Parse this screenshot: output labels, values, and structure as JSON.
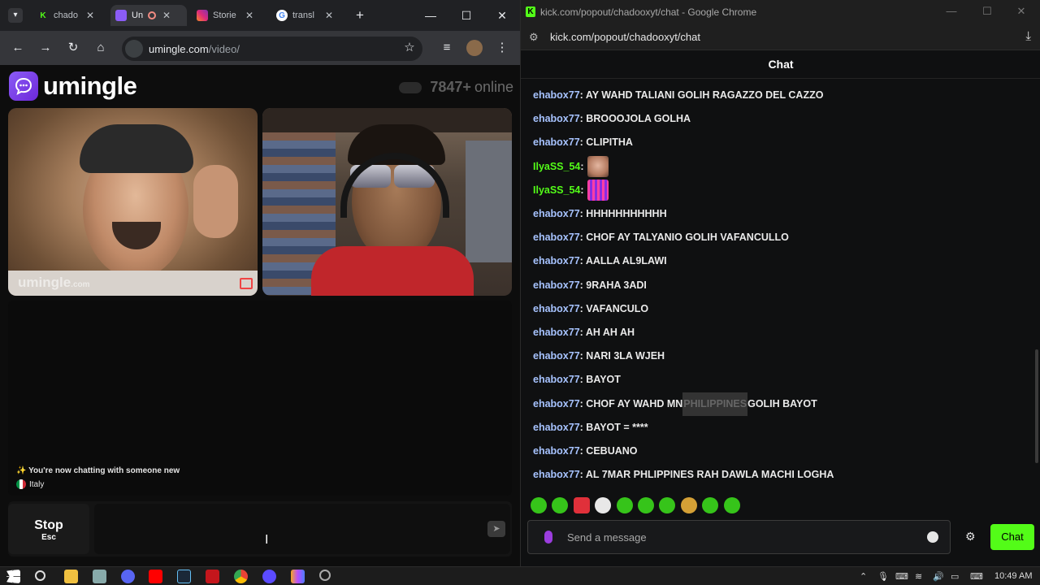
{
  "left_window": {
    "tabs": [
      {
        "label": "chado",
        "favicon": "K",
        "color": "#53fc18"
      },
      {
        "label": "Un",
        "favicon": "U",
        "color": "#8b5cf6"
      },
      {
        "label": "Storie",
        "favicon": "I",
        "color": "#e1306c"
      },
      {
        "label": "transl",
        "favicon": "G",
        "color": "#4285f4"
      }
    ],
    "new_tab": "+",
    "url_host": "umingle.com",
    "url_path": "/video/"
  },
  "umingle": {
    "logo_text": "umingle",
    "online_count": "7847+",
    "online_label": "online",
    "watermark": "umingle",
    "watermark_domain": ".com",
    "system_message": "You're now chatting with someone new",
    "country": "Italy",
    "stop_label": "Stop",
    "stop_shortcut": "Esc"
  },
  "right_window": {
    "title": "kick.com/popout/chadooxyt/chat - Google Chrome",
    "url": "kick.com/popout/chadooxyt/chat",
    "chat_header": "Chat",
    "messages": [
      {
        "user": "ehabox77",
        "text": ": AY WAHD TALIANI GOLIH RAGAZZO DEL CAZZO"
      },
      {
        "user": "ehabox77",
        "text": ": BROOOJOLA GOLHA"
      },
      {
        "user": "ehabox77",
        "text": ": CLIPITHA"
      },
      {
        "user": "IlyaSS_54",
        "text": ":",
        "emote": "face"
      },
      {
        "user": "IlyaSS_54",
        "text": ":",
        "emote": "dance"
      },
      {
        "user": "ehabox77",
        "text": ": HHHHHHHHHHH"
      },
      {
        "user": "ehabox77",
        "text": ": CHOF AY TALYANIO GOLIH VAFANCULLO"
      },
      {
        "user": "ehabox77",
        "text": ": AALLA AL9LAWI"
      },
      {
        "user": "ehabox77",
        "text": ": 9RAHA 3ADI"
      },
      {
        "user": "ehabox77",
        "text": ": VAFANCULO"
      },
      {
        "user": "ehabox77",
        "text": ": AH AH AH"
      },
      {
        "user": "ehabox77",
        "text": ": NARI 3LA WJEH"
      },
      {
        "user": "ehabox77",
        "text": ": BAYOT"
      },
      {
        "user": "ehabox77",
        "text": ": CHOF AY WAHD MN ",
        "highlight": "PHILIPPINES",
        "after": " GOLIH BAYOT"
      },
      {
        "user": "ehabox77",
        "text": ": BAYOT = ****"
      },
      {
        "user": "ehabox77",
        "text": ": CEBUANO"
      },
      {
        "user": "ehabox77",
        "text": ": AL 7MAR PHLIPPINES RAH DAWLA MACHI LOGHA"
      }
    ],
    "send_placeholder": "Send a message",
    "chat_button": "Chat"
  },
  "taskbar": {
    "time": "10:49 AM"
  },
  "colors": {
    "kick_green": "#53fc18",
    "username_blue": "#a7c3ff",
    "umingle_purple": "#8b5cf6"
  }
}
